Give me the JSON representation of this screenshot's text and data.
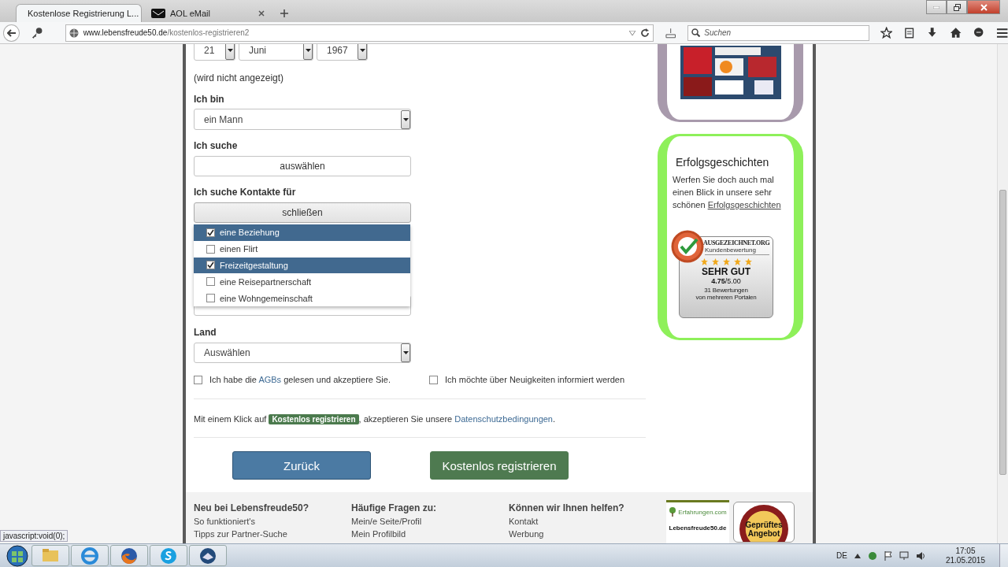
{
  "browser": {
    "tabs": [
      {
        "title": "Kostenlose Registrierung L...",
        "selected": true
      },
      {
        "title": "AOL eMail",
        "selected": false
      }
    ],
    "url_host": "www.lebensfreude50.de",
    "url_path": "/kostenlos-registrieren2",
    "search": {
      "placeholder": "Suchen"
    }
  },
  "form": {
    "birthdate": {
      "day": "21",
      "month": "Juni",
      "year": "1967"
    },
    "birthdate_note": "(wird nicht angezeigt)",
    "gender": {
      "label": "Ich bin",
      "value": "ein Mann"
    },
    "seeking": {
      "label": "Ich suche",
      "button": "auswählen"
    },
    "contacts": {
      "label": "Ich suche Kontakte für",
      "button": "schließen",
      "options": [
        {
          "label": "eine Beziehung",
          "checked": true
        },
        {
          "label": "einen Flirt",
          "checked": false
        },
        {
          "label": "Freizeitgestaltung",
          "checked": true
        },
        {
          "label": "eine Reisepartnerschaft",
          "checked": false
        },
        {
          "label": "eine Wohngemeinschaft",
          "checked": false
        }
      ]
    },
    "country": {
      "label": "Land",
      "value": "Auswählen"
    },
    "agb": {
      "before": "Ich habe die",
      "link": "AGBs",
      "after": "gelesen und akzeptiere Sie.",
      "checked": false
    },
    "newsletter": {
      "text": "Ich möchte über Neuigkeiten informiert werden",
      "checked": false
    },
    "consent": {
      "before": "Mit einem Klick auf",
      "tag": "Kostenlos registrieren",
      "middle": ", akzeptieren Sie unsere",
      "link": "Datenschutzbedingungen",
      "after": "."
    },
    "buttons": [
      {
        "label": "Zurück",
        "kind": "back"
      },
      {
        "label": "Kostenlos registrieren",
        "kind": "submit"
      }
    ]
  },
  "sidebar": {
    "stories": {
      "title": "Erfolgsgeschichten",
      "text": "Werfen Sie doch auch mal einen Blick in unsere sehr schönen",
      "link": "Erfolgsgeschichten"
    },
    "rating": {
      "brand": "AUSGEZEICHNET.ORG",
      "subtitle": "Kundenbewertung",
      "stars": 5,
      "verdict": "SEHR GUT",
      "score": "**4.75**/5.00",
      "count": "31 Bewertungen",
      "source": "von mehreren Portalen"
    }
  },
  "footer": {
    "columns": [
      {
        "heading": "Neu bei Lebensfreude50?",
        "links": [
          "So funktioniert's",
          "Tipps zur Partner-Suche"
        ]
      },
      {
        "heading": "Häufige Fragen zu:",
        "links": [
          "Mein/e Seite/Profil",
          "Mein Profilbild"
        ]
      },
      {
        "heading": "Können wir Ihnen helfen?",
        "links": [
          "Kontakt",
          "Werbung"
        ]
      }
    ],
    "review_badge": {
      "brand": "Erfahrungen.com",
      "site": "Lebensfreude50.de"
    },
    "seal": {
      "text": "Geprüftes Angebot"
    }
  },
  "status_tip": "javascript:void(0);",
  "taskbar": {
    "language": "DE",
    "time": "17:05",
    "date": "21.05.2015"
  }
}
